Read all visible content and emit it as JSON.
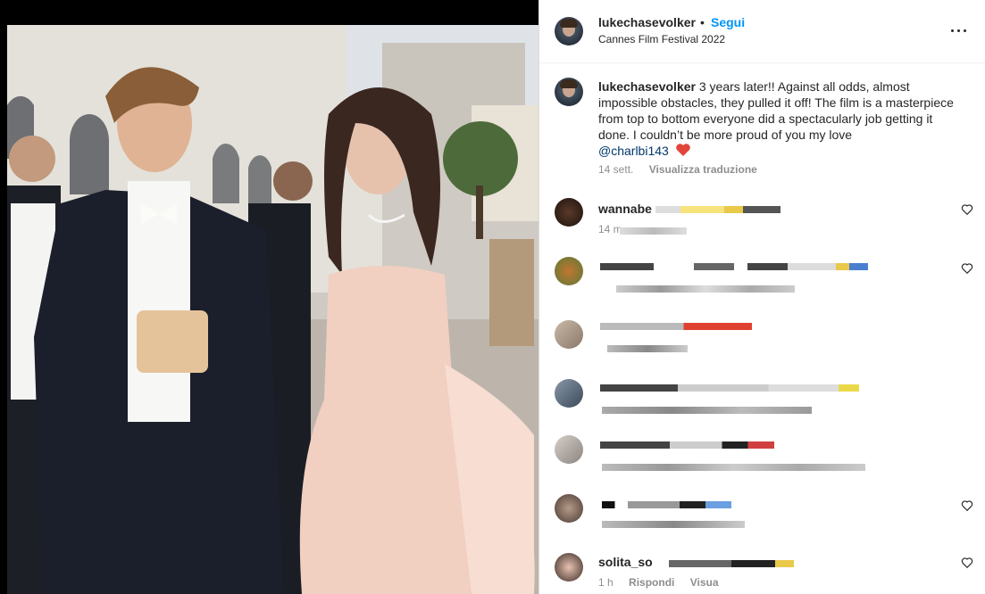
{
  "post": {
    "username": "lukechasevolker",
    "separator": "•",
    "follow_label": "Segui",
    "location": "Cannes Film Festival 2022",
    "more_icon": "more-horizontal-icon"
  },
  "caption": {
    "username": "lukechasevolker",
    "text": "3 years later!! Against all odds, almost impossible obstacles, they pulled it off! The film is a masterpiece from top to bottom everyone did a spectacularly job getting it done. I couldn’t be more proud of you my love",
    "mention": "@charlbi143",
    "emoji": "heart-emoji",
    "time": "14 sett.",
    "translate_label": "Visualizza traduzione"
  },
  "comments": [
    {
      "name": "wannabe",
      "time": "14 m",
      "reply_label": "",
      "translate_label": ""
    },
    {
      "name": "",
      "time": "",
      "reply_label": "",
      "translate_label": ""
    },
    {
      "name": "",
      "time": "",
      "reply_label": "",
      "translate_label": ""
    },
    {
      "name": "",
      "time": "",
      "reply_label": "",
      "translate_label": ""
    },
    {
      "name": "",
      "time": "",
      "reply_label": "",
      "translate_label": ""
    },
    {
      "name": "",
      "time": "",
      "reply_label": "",
      "translate_label": ""
    },
    {
      "name": "solita_so",
      "time": "1 h",
      "reply_label": "Rispondi",
      "translate_label": "Visua"
    }
  ],
  "colors": {
    "link": "#0095f6",
    "mention": "#00376b",
    "text": "#262626",
    "muted": "#8e8e8e"
  }
}
